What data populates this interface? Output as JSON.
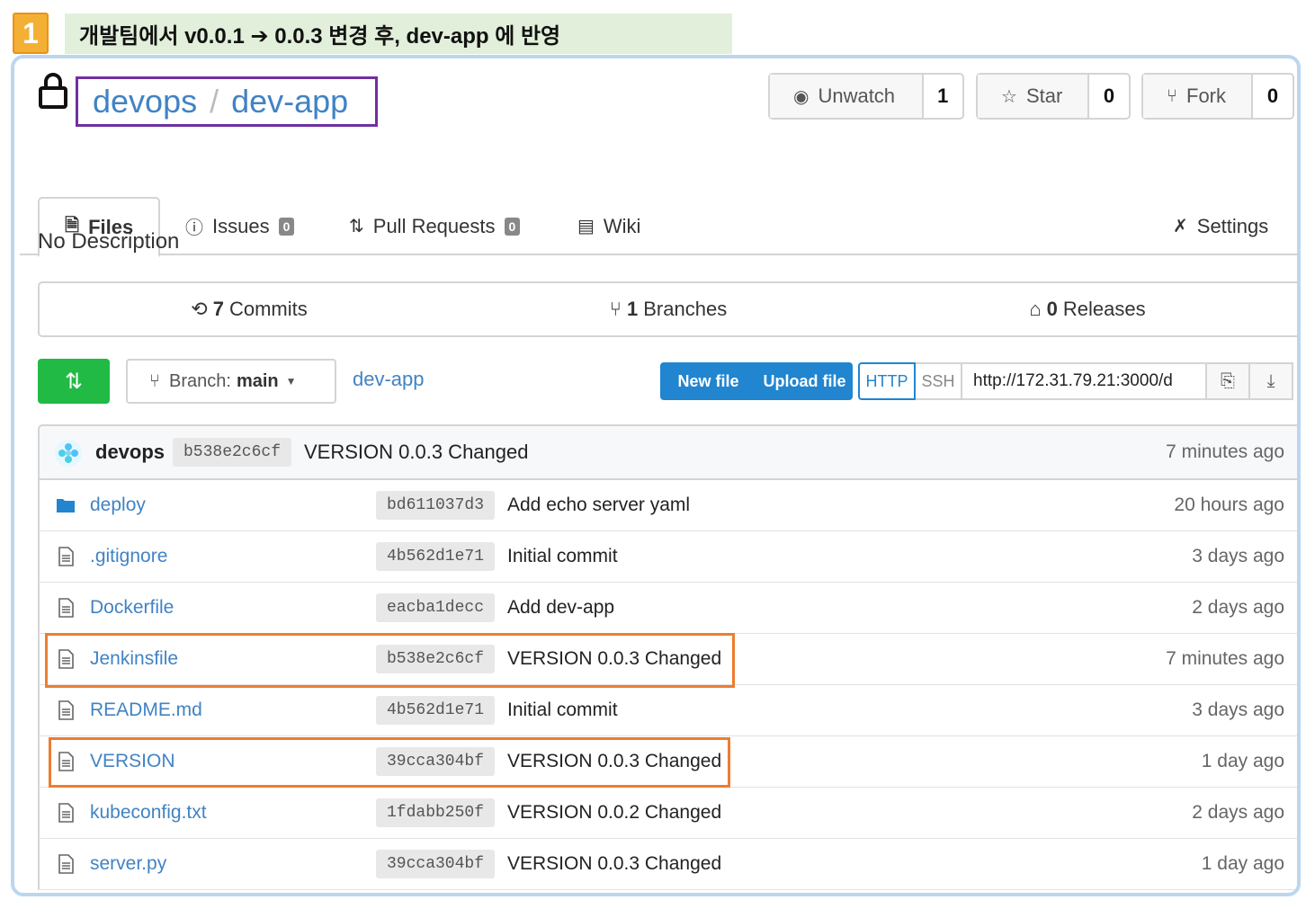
{
  "step": {
    "number": "1",
    "caption": "개발팀에서 v0.0.1 ➔ 0.0.3 변경 후, dev-app 에 반영"
  },
  "repo": {
    "owner": "devops",
    "separator": "/",
    "name": "dev-app"
  },
  "actions": {
    "unwatch": {
      "label": "Unwatch",
      "count": "1"
    },
    "star": {
      "label": "Star",
      "count": "0"
    },
    "fork": {
      "label": "Fork",
      "count": "0"
    }
  },
  "tabs": {
    "files": "Files",
    "issues": {
      "label": "Issues",
      "count": "0"
    },
    "pulls": {
      "label": "Pull Requests",
      "count": "0"
    },
    "wiki": "Wiki",
    "settings": "Settings"
  },
  "description": "No Description",
  "stats": {
    "commits": {
      "count": "7",
      "label": "Commits"
    },
    "branches": {
      "count": "1",
      "label": "Branches"
    },
    "releases": {
      "count": "0",
      "label": "Releases"
    }
  },
  "toolbar": {
    "branch_prefix": "Branch:",
    "branch_name": "main",
    "breadcrumb": "dev-app",
    "new_file": "New file",
    "upload_file": "Upload file",
    "http": "HTTP",
    "ssh": "SSH",
    "clone_url": "http://172.31.79.21:3000/d"
  },
  "latest_commit": {
    "author": "devops",
    "sha": "b538e2c6cf",
    "message": "VERSION 0.0.3 Changed",
    "age": "7 minutes ago"
  },
  "files": [
    {
      "name": "deploy",
      "type": "folder",
      "sha": "bd611037d3",
      "message": "Add echo server yaml",
      "age": "20 hours ago"
    },
    {
      "name": ".gitignore",
      "type": "file",
      "sha": "4b562d1e71",
      "message": "Initial commit",
      "age": "3 days ago"
    },
    {
      "name": "Dockerfile",
      "type": "file",
      "sha": "eacba1decc",
      "message": "Add dev-app",
      "age": "2 days ago"
    },
    {
      "name": "Jenkinsfile",
      "type": "file",
      "sha": "b538e2c6cf",
      "message": "VERSION 0.0.3 Changed",
      "age": "7 minutes ago"
    },
    {
      "name": "README.md",
      "type": "file",
      "sha": "4b562d1e71",
      "message": "Initial commit",
      "age": "3 days ago"
    },
    {
      "name": "VERSION",
      "type": "file",
      "sha": "39cca304bf",
      "message": "VERSION 0.0.3 Changed",
      "age": "1 day ago"
    },
    {
      "name": "kubeconfig.txt",
      "type": "file",
      "sha": "1fdabb250f",
      "message": "VERSION 0.0.2 Changed",
      "age": "2 days ago"
    },
    {
      "name": "server.py",
      "type": "file",
      "sha": "39cca304bf",
      "message": "VERSION 0.0.3 Changed",
      "age": "1 day ago"
    }
  ],
  "colors": {
    "link": "#4183c4",
    "primary": "#2185d0",
    "green": "#21ba45",
    "highlight": "#ed7d31",
    "title_box": "#7030a0"
  }
}
